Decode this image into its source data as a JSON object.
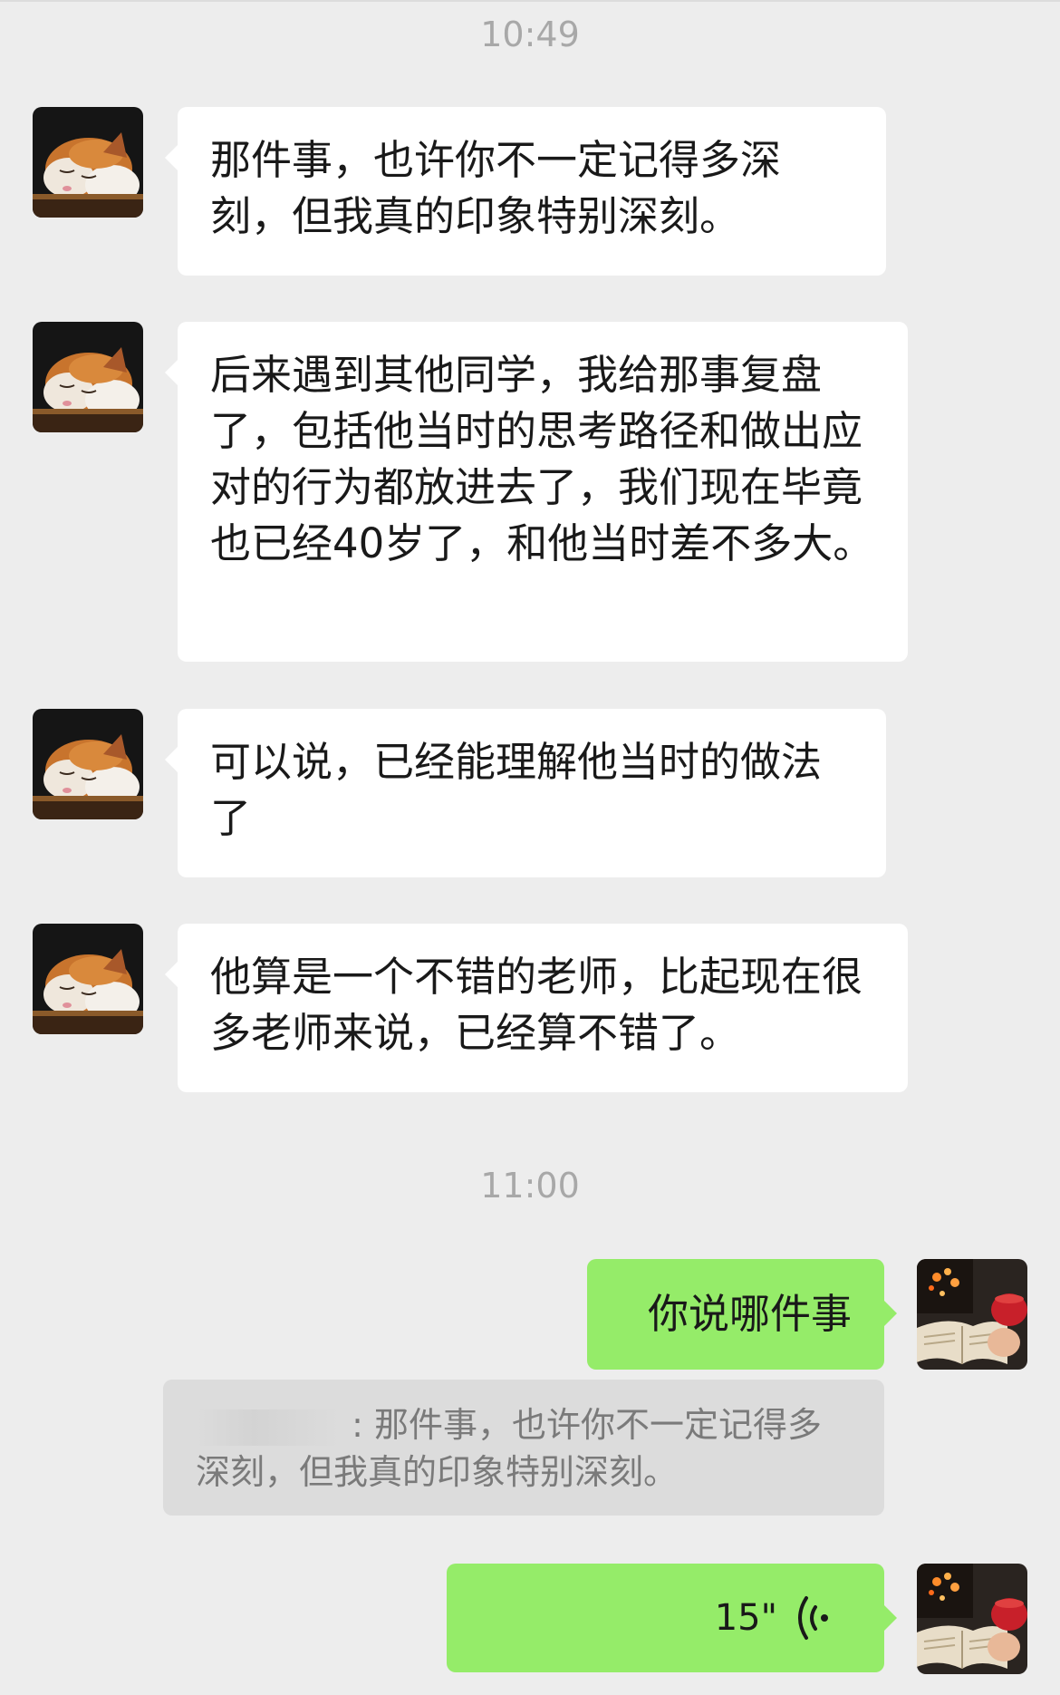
{
  "chat": {
    "timestamps": [
      "10:49",
      "11:00"
    ],
    "messages": [
      {
        "side": "left",
        "text": "那件事，也许你不一定记得多深刻，但我真的印象特别深刻。",
        "avatar_icon": "sleeping-cat-avatar-icon"
      },
      {
        "side": "left",
        "text": "后来遇到其他同学，我给那事复盘了，包括他当时的思考路径和做出应对的行为都放进去了，我们现在毕竟也已经40岁了，和他当时差不多大。",
        "avatar_icon": "sleeping-cat-avatar-icon"
      },
      {
        "side": "left",
        "text": "可以说，已经能理解他当时的做法了",
        "avatar_icon": "sleeping-cat-avatar-icon"
      },
      {
        "side": "left",
        "text": "他算是一个不错的老师，比起现在很多老师来说，已经算不错了。",
        "avatar_icon": "sleeping-cat-avatar-icon"
      },
      {
        "side": "right",
        "text": "你说哪件事",
        "avatar_icon": "book-and-mug-avatar-icon"
      },
      {
        "side": "right",
        "type": "voice",
        "duration": "15\"",
        "avatar_icon": "book-and-mug-avatar-icon",
        "voice_icon": "voice-wave-icon"
      }
    ],
    "quote": {
      "separator": ":",
      "text": "那件事，也许你不一定记得多深刻，但我真的印象特别深刻。"
    }
  },
  "colors": {
    "background": "#ededed",
    "incoming_bubble": "#ffffff",
    "outgoing_bubble": "#95ec69",
    "quote_bg": "#dcdcdc",
    "timestamp": "#a8a8a8"
  }
}
